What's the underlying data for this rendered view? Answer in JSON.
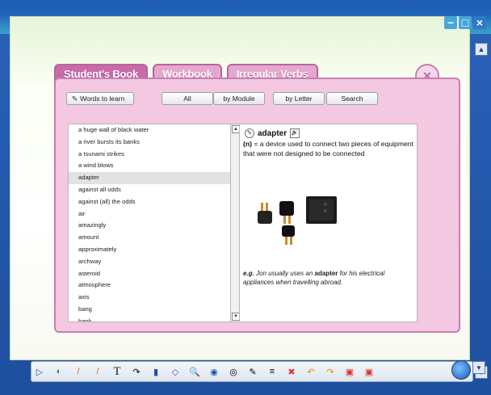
{
  "window": {
    "controls": [
      "minimize",
      "maximize",
      "close"
    ]
  },
  "tabs": [
    {
      "label": "Student's Book",
      "active": true
    },
    {
      "label": "Workbook",
      "active": false
    },
    {
      "label": "Irregular Verbs",
      "active": false
    }
  ],
  "dialog": {
    "close_label": "×"
  },
  "toolbar": {
    "words_to_learn": "Words to learn",
    "all": "All",
    "by_module": "by Module",
    "by_letter": "by Letter",
    "search": "Search"
  },
  "wordlist": {
    "items": [
      "a huge wall of black water",
      "a river bursts its banks",
      "a tsunami strikes",
      "a wind blows",
      "adapter",
      "against all odds",
      "against (all) the odds",
      "air",
      "amazingly",
      "amount",
      "approximately",
      "archway",
      "asteroid",
      "atmosphere",
      "axis",
      "bang",
      "bank"
    ],
    "selected_index": 4
  },
  "definition": {
    "headword": "adapter",
    "pos": "(n)",
    "text": "= a device used to connect two pieces of equipment that were not designed to be connected",
    "example_prefix": "e.g.",
    "example_pre": "Jon usually uses an",
    "example_word": "adapter",
    "example_post": "for his electrical appliances when travelling abroad."
  },
  "bottom_tools": [
    {
      "name": "play-triangle-icon",
      "glyph": "▷"
    },
    {
      "name": "lasso-icon",
      "glyph": "◐"
    },
    {
      "name": "pencil-icon",
      "glyph": "/"
    },
    {
      "name": "pen-icon",
      "glyph": "/"
    },
    {
      "name": "text-tool-icon",
      "glyph": "T"
    },
    {
      "name": "curve-icon",
      "glyph": "↷"
    },
    {
      "name": "fill-icon",
      "glyph": "▮"
    },
    {
      "name": "eraser-icon",
      "glyph": "◇"
    },
    {
      "name": "zoom-icon",
      "glyph": "🔍"
    },
    {
      "name": "spotlight-icon",
      "glyph": "◉"
    },
    {
      "name": "reveal-icon",
      "glyph": "◎"
    },
    {
      "name": "clipboard-icon",
      "glyph": "✎"
    },
    {
      "name": "menu-icon",
      "glyph": "≡"
    },
    {
      "name": "delete-icon",
      "glyph": "✖"
    },
    {
      "name": "undo-icon",
      "glyph": "↶"
    },
    {
      "name": "redo-icon",
      "glyph": "↷"
    },
    {
      "name": "bookmark-icon",
      "glyph": "▣"
    },
    {
      "name": "bookmark2-icon",
      "glyph": "▣"
    }
  ]
}
